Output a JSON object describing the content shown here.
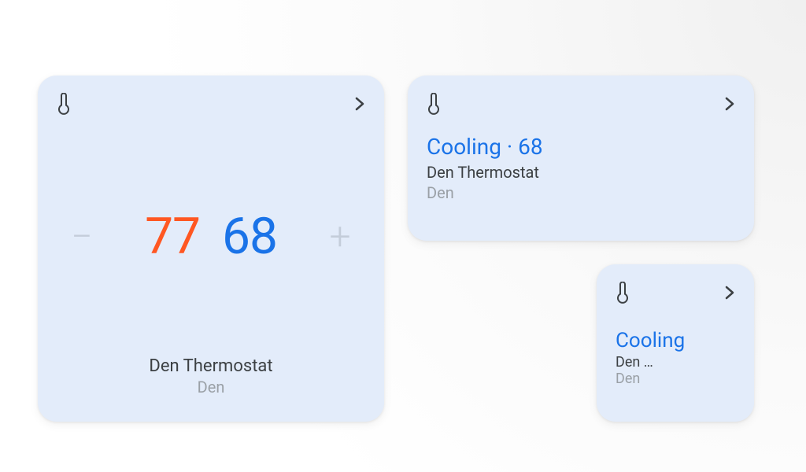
{
  "colors": {
    "card_bg": "#e3ecfa",
    "heat": "#ff5722",
    "cool": "#1a73e8",
    "text_primary": "#3c4043",
    "text_secondary": "#9aa0a6",
    "disabled": "#c4cdda"
  },
  "large_card": {
    "temp_high": "77",
    "temp_low": "68",
    "minus": "−",
    "plus": "+",
    "device": "Den Thermostat",
    "room": "Den"
  },
  "medium_card": {
    "status_line": "Cooling · 68",
    "device": "Den Thermostat",
    "room": "Den"
  },
  "small_card": {
    "status_line": "Cooling",
    "device": "Den …",
    "room": "Den"
  }
}
